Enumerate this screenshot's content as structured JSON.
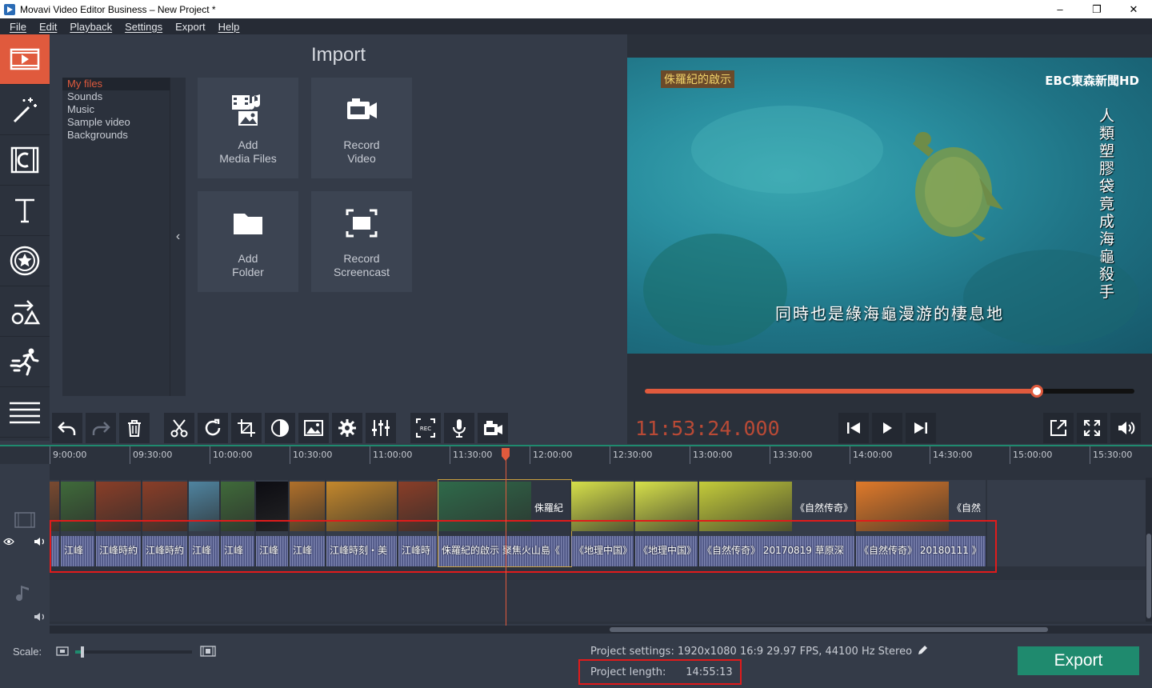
{
  "window": {
    "title": "Movavi Video Editor Business – New Project *",
    "minimize": "–",
    "maximize": "❐",
    "close": "✕"
  },
  "menu": [
    "File",
    "Edit",
    "Playback",
    "Settings",
    "Export",
    "Help"
  ],
  "left_tools": [
    "import-icon",
    "magic-wand-icon",
    "filters-icon",
    "titles-icon",
    "stickers-icon",
    "transitions-icon",
    "motion-icon",
    "more-icon"
  ],
  "import": {
    "title": "Import",
    "tree": [
      "My files",
      "Sounds",
      "Music",
      "Sample video",
      "Backgrounds"
    ],
    "collapse": "‹",
    "tiles": [
      {
        "label": "Add\nMedia Files",
        "icon": "add-media-files-icon"
      },
      {
        "label": "Record\nVideo",
        "icon": "record-video-icon"
      },
      {
        "label": "Add\nFolder",
        "icon": "add-folder-icon"
      },
      {
        "label": "Record\nScreencast",
        "icon": "record-screencast-icon"
      }
    ]
  },
  "preview": {
    "tag": "侏羅紀的啟示",
    "logo": "EBC東森新聞HD",
    "vertical_caption": "人類塑膠袋 竟成海龜殺手",
    "subtitle": "同時也是綠海龜漫游的棲息地",
    "progress": 0.8
  },
  "edit_toolbar": [
    "undo-icon",
    "redo-icon",
    "delete-icon",
    "cut-icon",
    "rotate-icon",
    "crop-icon",
    "color-adjust-icon",
    "image-icon",
    "settings-icon",
    "equalizer-icon",
    "record-screen-icon",
    "microphone-icon",
    "camera-icon"
  ],
  "player": {
    "timecode": "11:53:24.000",
    "controls": [
      "skip-back-icon",
      "play-icon",
      "skip-forward-icon",
      "popout-icon",
      "fullscreen-icon",
      "volume-icon"
    ]
  },
  "ruler": [
    "9:00:00",
    "09:30:00",
    "10:00:00",
    "10:30:00",
    "11:00:00",
    "11:30:00",
    "12:00:00",
    "12:30:00",
    "13:00:00",
    "13:30:00",
    "14:00:00",
    "14:30:00",
    "15:00:00",
    "15:30:00"
  ],
  "clips": [
    {
      "label": "",
      "title": "",
      "thumb": "#7a4a30"
    },
    {
      "label": "江峰",
      "title": "",
      "thumb": "#3f6a3a"
    },
    {
      "label": "江峰時約",
      "title": "",
      "thumb": "#8a3e28"
    },
    {
      "label": "江峰時約",
      "title": "",
      "thumb": "#8a3e28"
    },
    {
      "label": "江峰",
      "title": "",
      "thumb": "#4f84a0"
    },
    {
      "label": "江峰",
      "title": "",
      "thumb": "#3f6a3a"
    },
    {
      "label": "江峰",
      "title": "",
      "thumb": "#0c0c12"
    },
    {
      "label": "江峰",
      "title": "",
      "thumb": "#b0702a"
    },
    {
      "label": "江峰時刻・美",
      "title": "",
      "thumb": "#c4882c"
    },
    {
      "label": "江峰時",
      "title": "",
      "thumb": "#8a3e28"
    },
    {
      "label": "侏羅紀的啟示 聚焦火山島《",
      "title": "侏羅紀",
      "thumb": "#2f6a4a"
    },
    {
      "label": "《地理中国》",
      "title": "",
      "thumb": "#d6e04a"
    },
    {
      "label": "《地理中国》",
      "title": "",
      "thumb": "#d6e04a"
    },
    {
      "label": "《自然传奇》 20170819 草原深",
      "title": "《自然传奇》",
      "thumb": "#c4cc3a"
    },
    {
      "label": "《自然传奇》 20180111 》",
      "title": "《自然",
      "thumb": "#e07a2a"
    }
  ],
  "footer": {
    "scale_label": "Scale:",
    "scale_value": 0.05,
    "project_settings": "Project settings:  1920x1080 16:9 29.97 FPS, 44100 Hz Stereo",
    "project_length_label": "Project length:",
    "project_length_value": "14:55:13",
    "export_label": "Export"
  },
  "colors": {
    "accent": "#e05a3d",
    "export": "#1f8a6e",
    "highlight_box": "#e01b1b"
  }
}
